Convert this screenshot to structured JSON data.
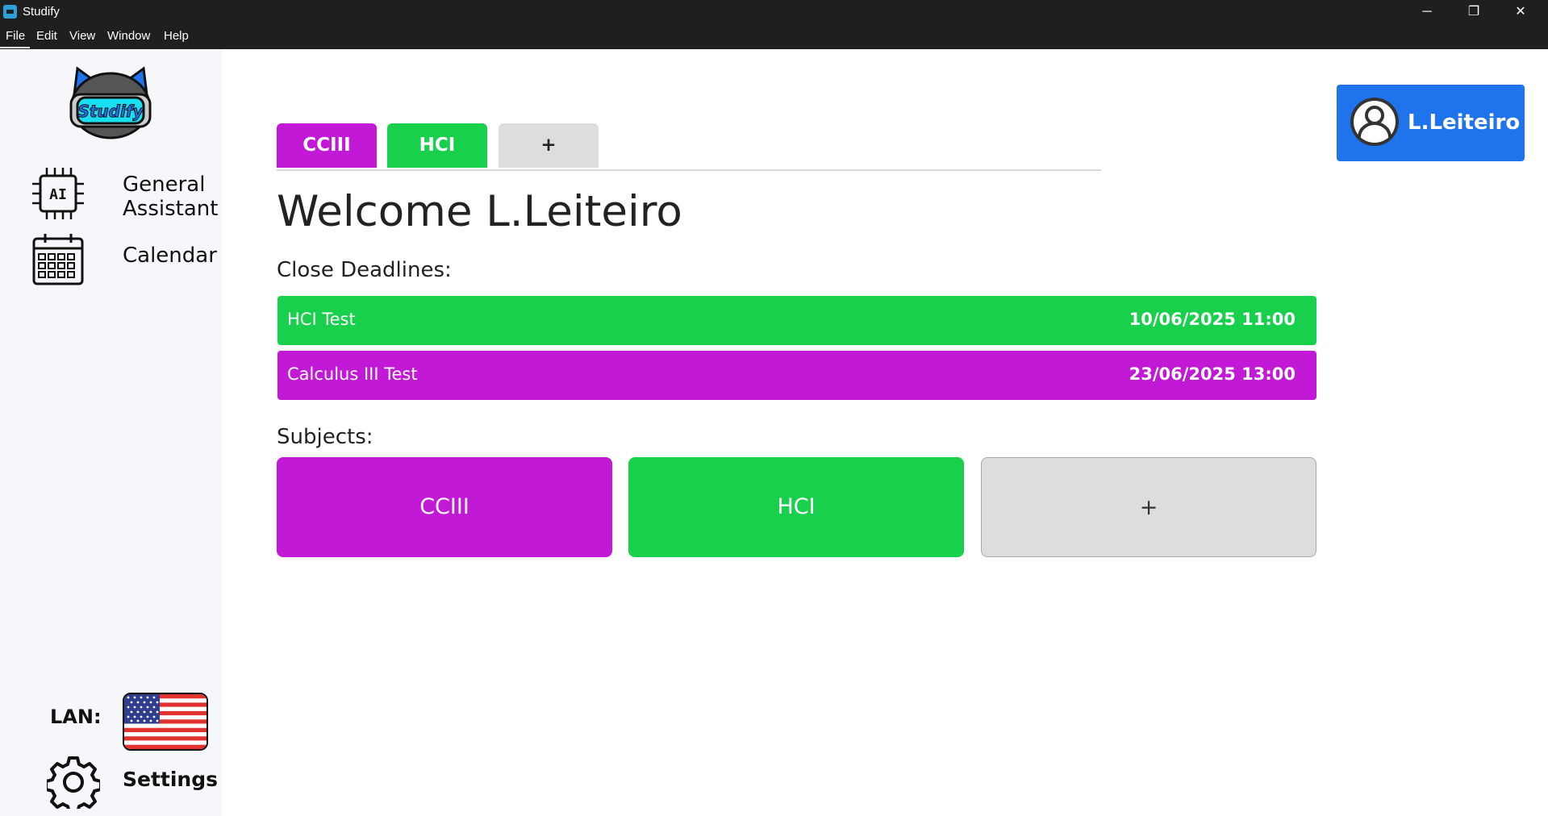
{
  "window": {
    "title": "Studify",
    "minimize": "─",
    "maximize": "❐",
    "close": "✕"
  },
  "menu": [
    "File",
    "Edit",
    "View",
    "Window",
    "Help"
  ],
  "sidebar": {
    "logo_text": "Studify",
    "items": [
      {
        "label_line1": "General",
        "label_line2": "Assistant",
        "icon": "ai-chip-icon"
      },
      {
        "label": "Calendar",
        "icon": "calendar-icon"
      }
    ],
    "language_label": "LAN:",
    "language_flag": "us-flag-icon",
    "settings_label": "Settings"
  },
  "tabs": [
    {
      "label": "CCIII",
      "color": "#c119d6"
    },
    {
      "label": "HCI",
      "color": "#19d04c"
    },
    {
      "label": "+",
      "color": "#dddddd"
    }
  ],
  "welcome": "Welcome L.Leiteiro",
  "deadlines_label": "Close Deadlines:",
  "deadlines": [
    {
      "name": "HCI Test",
      "date": "10/06/2025 11:00",
      "color": "#19d04c"
    },
    {
      "name": "Calculus III Test",
      "date": "23/06/2025 13:00",
      "color": "#c119d6"
    }
  ],
  "subjects_label": "Subjects:",
  "subjects": [
    {
      "label": "CCIII",
      "color": "#c119d6"
    },
    {
      "label": "HCI",
      "color": "#19d04c"
    },
    {
      "label": "+",
      "color": "#dddddd"
    }
  ],
  "profile": {
    "name": "L.Leiteiro",
    "color": "#1f73ec"
  }
}
